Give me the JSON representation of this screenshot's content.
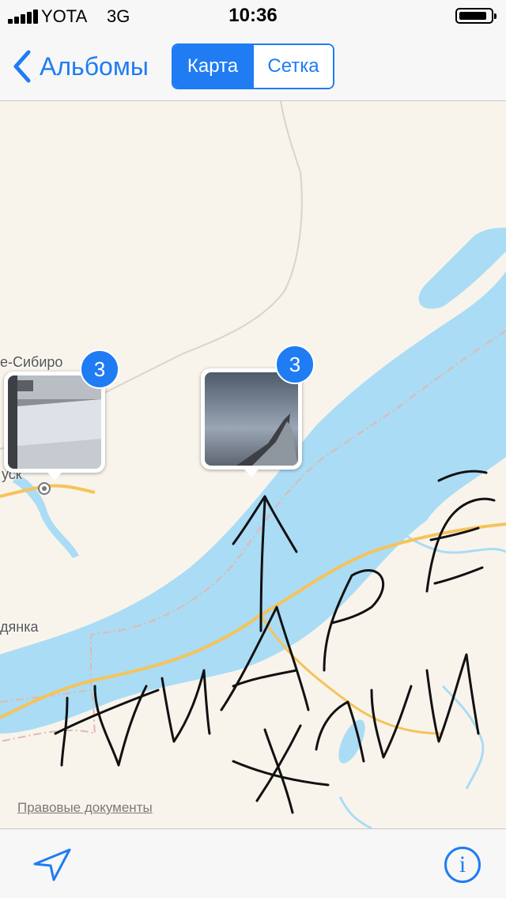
{
  "status_bar": {
    "carrier": "YOTA",
    "network": "3G",
    "time": "10:36"
  },
  "nav": {
    "back_label": "Альбомы",
    "segments": [
      {
        "label": "Карта",
        "selected": true
      },
      {
        "label": "Сетка",
        "selected": false
      }
    ]
  },
  "map": {
    "labels": {
      "city_top": "е-Сибиро",
      "city_mid": "уск",
      "city_bottom": "дянка"
    },
    "legal_link": "Правовые документы",
    "pins": [
      {
        "count": "3"
      },
      {
        "count": "3"
      }
    ],
    "handwriting_icon": "handwritten-scribble"
  },
  "toolbar": {
    "location_icon": "location-arrow-icon",
    "info_label": "i"
  },
  "colors": {
    "accent": "#1f7cf3",
    "water": "#aadcf5",
    "land": "#f8f4ec",
    "road": "#f6c35a"
  }
}
